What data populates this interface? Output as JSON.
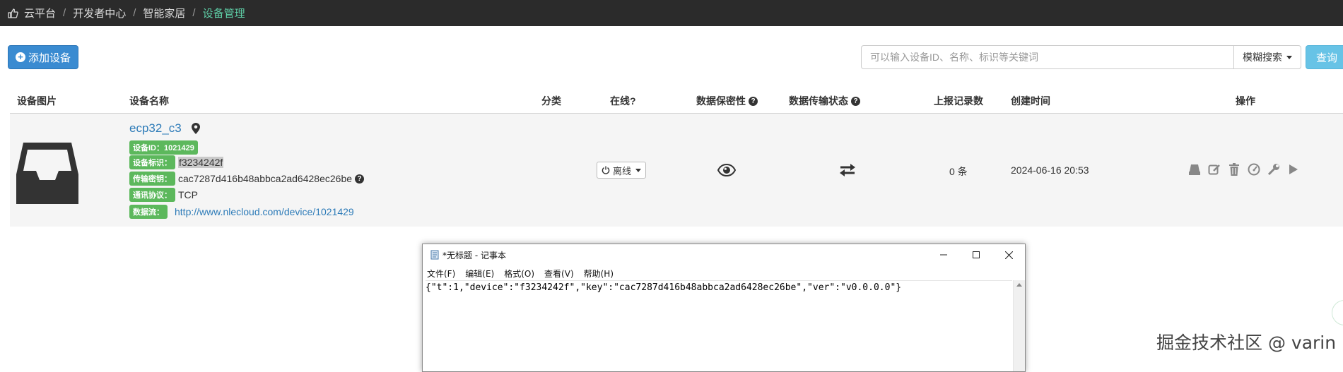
{
  "breadcrumb": {
    "items": [
      "云平台",
      "开发者中心",
      "智能家居"
    ],
    "current": "设备管理",
    "separator": "/"
  },
  "toolbar": {
    "add_label": "添加设备",
    "search_placeholder": "可以输入设备ID、名称、标识等关键词",
    "search_mode": "模糊搜索",
    "query_label": "查询"
  },
  "table": {
    "headers": {
      "image": "设备图片",
      "name": "设备名称",
      "category": "分类",
      "online": "在线?",
      "privacy": "数据保密性",
      "transfer": "数据传输状态",
      "records": "上报记录数",
      "created": "创建时间",
      "actions": "操作"
    },
    "row": {
      "name": "ecp32_c3",
      "id_label": "设备ID：",
      "id_value": "1021429",
      "ident_label": "设备标识：",
      "ident_value": "f3234242f",
      "key_label": "传输密钥：",
      "key_value": "cac7287d416b48abbca2ad6428ec26be",
      "protocol_label": "通讯协议：",
      "protocol_value": "TCP",
      "url_label": "数据流：",
      "url_value": "http://www.nlecloud.com/device/1021429",
      "status": "离线",
      "records": "0 条",
      "created": "2024-06-16 20:53",
      "action_icons": [
        "print-icon",
        "edit-icon",
        "delete-icon",
        "gauge-icon",
        "wrench-icon",
        "play-icon"
      ]
    }
  },
  "notepad": {
    "title": "*无标题 - 记事本",
    "menu": [
      "文件(F)",
      "编辑(E)",
      "格式(O)",
      "查看(V)",
      "帮助(H)"
    ],
    "content": "{\"t\":1,\"device\":\"f3234242f\",\"key\":\"cac7287d416b48abbca2ad6428ec26be\",\"ver\":\"v0.0.0.0\"}"
  },
  "watermark": "掘金技术社区 @ varin",
  "colors": {
    "topbar": "#2b2b2b",
    "active_crumb": "#5fd0a8",
    "primary": "#3a8bd1",
    "tag_green": "#5cb85c",
    "link": "#2d7bb8",
    "query": "#67c3e6"
  }
}
